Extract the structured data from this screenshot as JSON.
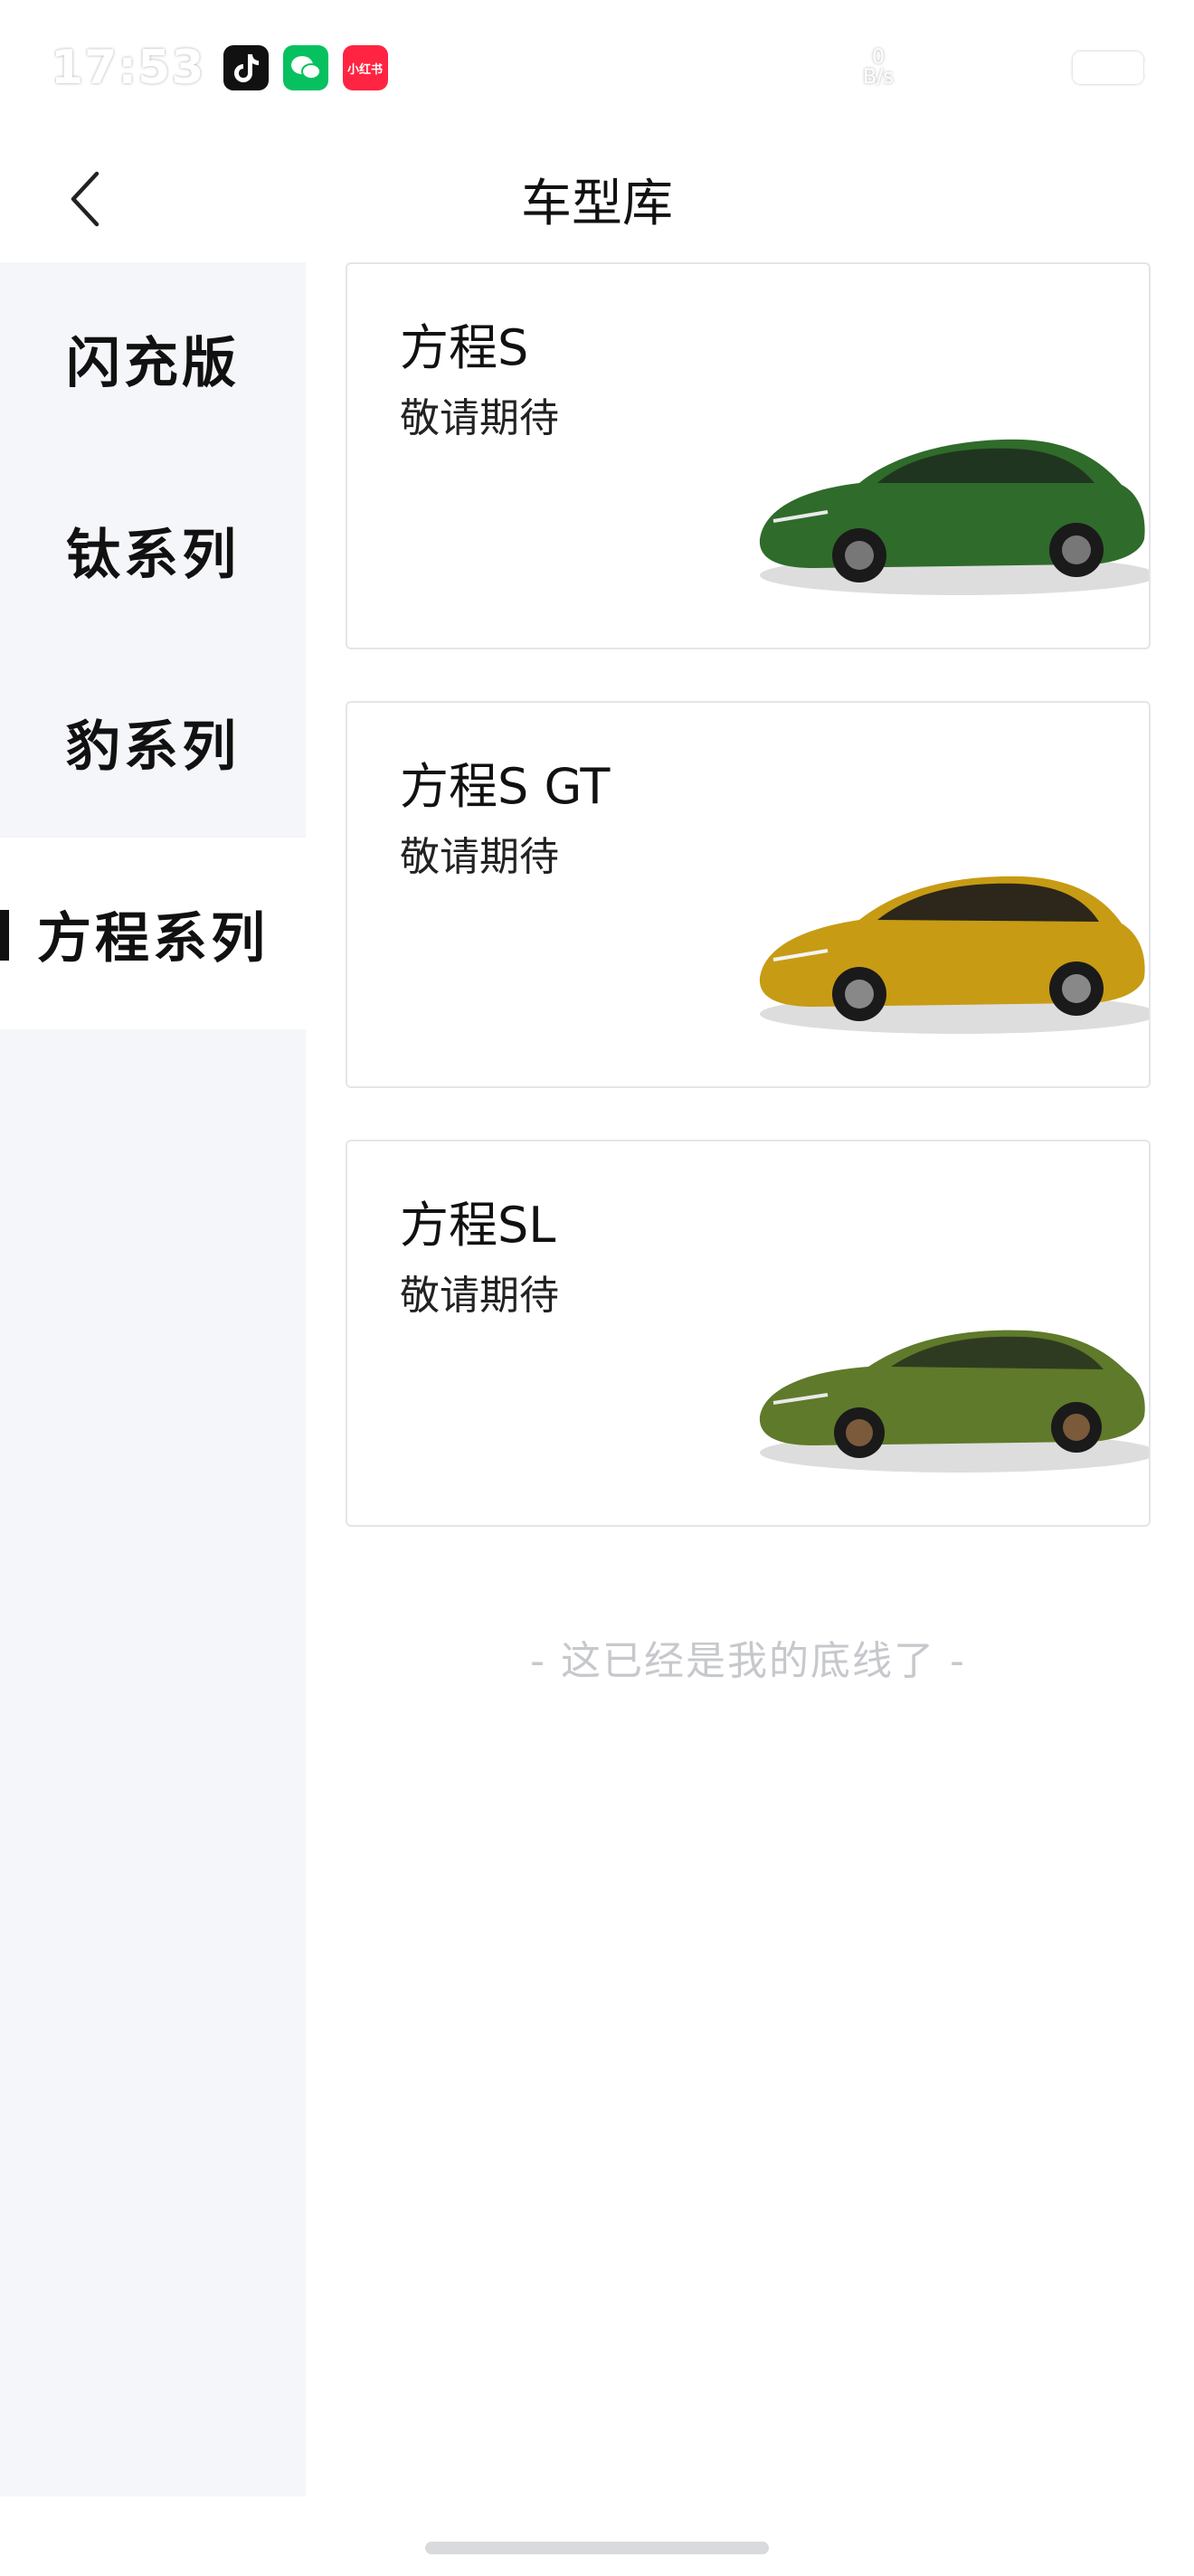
{
  "status_bar": {
    "time": "17:53",
    "apps": [
      "tiktok-icon",
      "wechat-icon",
      "xiaohongshu-icon"
    ],
    "xhs_label": "小红书",
    "net_speed_value": "0",
    "net_speed_unit": "B/s"
  },
  "header": {
    "title": "车型库"
  },
  "sidebar": {
    "items": [
      {
        "label": "闪充版",
        "active": false
      },
      {
        "label": "钛系列",
        "active": false
      },
      {
        "label": "豹系列",
        "active": false
      },
      {
        "label": "方程系列",
        "active": true
      }
    ]
  },
  "cards": [
    {
      "name": "方程S",
      "status": "敬请期待",
      "car_color": "#2f6b2a"
    },
    {
      "name": "方程S GT",
      "status": "敬请期待",
      "car_color": "#c79b14"
    },
    {
      "name": "方程SL",
      "status": "敬请期待",
      "car_color": "#5f7a2a"
    }
  ],
  "footer_note": "- 这已经是我的底线了 -"
}
